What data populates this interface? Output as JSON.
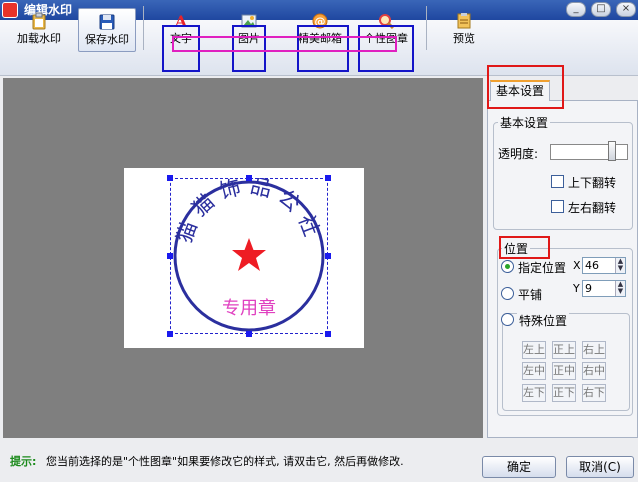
{
  "window": {
    "title": "编辑水印",
    "minimize": "_",
    "maximize": "□",
    "close": "×"
  },
  "toolbar": {
    "load": "加载水印",
    "save": "保存水印",
    "text": "文字",
    "image": "图片",
    "mailbox": "精美邮箱",
    "stamp": "个性图章",
    "preview": "预览"
  },
  "stamp": {
    "top_text": "猫猫饰品公社",
    "bottom_text": "专用章",
    "ring_color": "#2b2f9e",
    "star_color": "#ee1c24",
    "bottom_color": "#e040c0"
  },
  "panel": {
    "tab": "基本设置",
    "basic_group": "基本设置",
    "opacity_label": "透明度:",
    "flip_v": "上下翻转",
    "flip_h": "左右翻转",
    "position_group": "位置",
    "fixed_position": "指定位置",
    "x_label": "X",
    "x_value": "46",
    "y_label": "Y",
    "y_value": "9",
    "tile": "平铺",
    "special_position": "特殊位置",
    "grid": [
      "左上",
      "正上",
      "右上",
      "左中",
      "正中",
      "右中",
      "左下",
      "正下",
      "右下"
    ]
  },
  "status": {
    "hint_label": "提示:",
    "hint_text": "您当前选择的是\"个性图章\"如果要修改它的样式, 请双击它, 然后再做修改."
  },
  "buttons": {
    "ok": "确定",
    "cancel": "取消(C)"
  },
  "colors": {
    "highlight_blue": "#1414c8",
    "highlight_pink": "#e020c0",
    "highlight_red": "#e01818",
    "canvas": "#7f7f7f"
  }
}
